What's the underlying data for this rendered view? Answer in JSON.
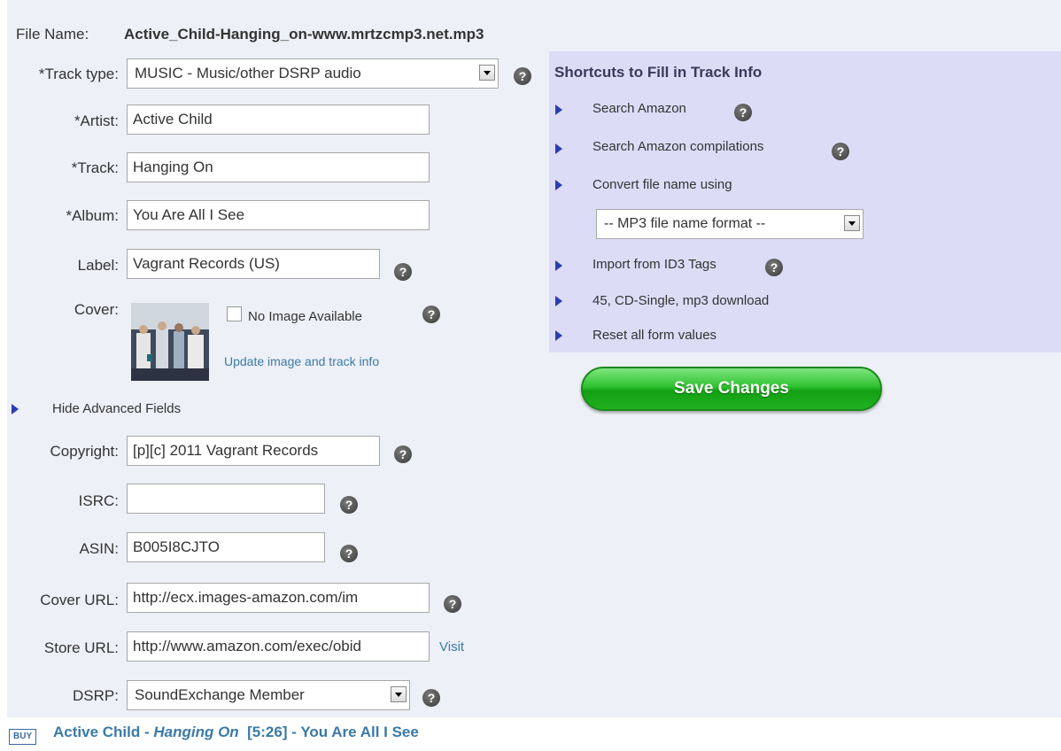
{
  "file": {
    "label": "File Name:",
    "value": "Active_Child-Hanging_on-www.mrtzcmp3.net.mp3"
  },
  "form": {
    "track_type": {
      "label": "*Track type:",
      "value": "MUSIC - Music/other DSRP audio"
    },
    "artist": {
      "label": "*Artist:",
      "value": "Active Child"
    },
    "track": {
      "label": "*Track:",
      "value": "Hanging On"
    },
    "album": {
      "label": "*Album:",
      "value": "You Are All I See"
    },
    "label_field": {
      "label": "Label:",
      "value": "Vagrant Records (US)"
    },
    "cover": {
      "label": "Cover:",
      "no_image_label": "No Image Available",
      "update_link": "Update image and track info"
    },
    "advanced_toggle": "Hide Advanced Fields",
    "copyright": {
      "label": "Copyright:",
      "value": "[p][c] 2011 Vagrant Records"
    },
    "isrc": {
      "label": "ISRC:",
      "value": ""
    },
    "asin": {
      "label": "ASIN:",
      "value": "B005I8CJTO"
    },
    "cover_url": {
      "label": "Cover URL:",
      "value": "http://ecx.images-amazon.com/im"
    },
    "store_url": {
      "label": "Store URL:",
      "value": "http://www.amazon.com/exec/obid",
      "visit_link": "Visit"
    },
    "dsrp": {
      "label": "DSRP:",
      "value": "SoundExchange Member"
    }
  },
  "help_glyph": "?",
  "shortcuts": {
    "title": "Shortcuts to Fill in Track Info",
    "search_amazon": "Search Amazon",
    "search_compilations": "Search Amazon compilations",
    "convert_file_name": "Convert file name using",
    "mp3_format_select": "-- MP3 file name format --",
    "import_id3": "Import from ID3 Tags",
    "release_type": "45, CD-Single, mp3 download",
    "reset": "Reset all form values"
  },
  "save_button": "Save Changes",
  "footer": {
    "buy": "BUY",
    "artist": "Active Child",
    "dash1": " - ",
    "track": "Hanging On",
    "duration": "[5:26]",
    "dash2": " - ",
    "album": "You Are All I See"
  },
  "colors": {
    "panel_bg": "#eef0f7",
    "shortcut_bg": "#dcdcf7",
    "link": "#3a7aa8",
    "triangle": "#2b3eae",
    "save_green": "#1fb01f"
  },
  "icons": {
    "help": "question-circle-icon",
    "bullet": "triangle-right-icon",
    "dropdown": "dropdown-arrow-icon"
  }
}
